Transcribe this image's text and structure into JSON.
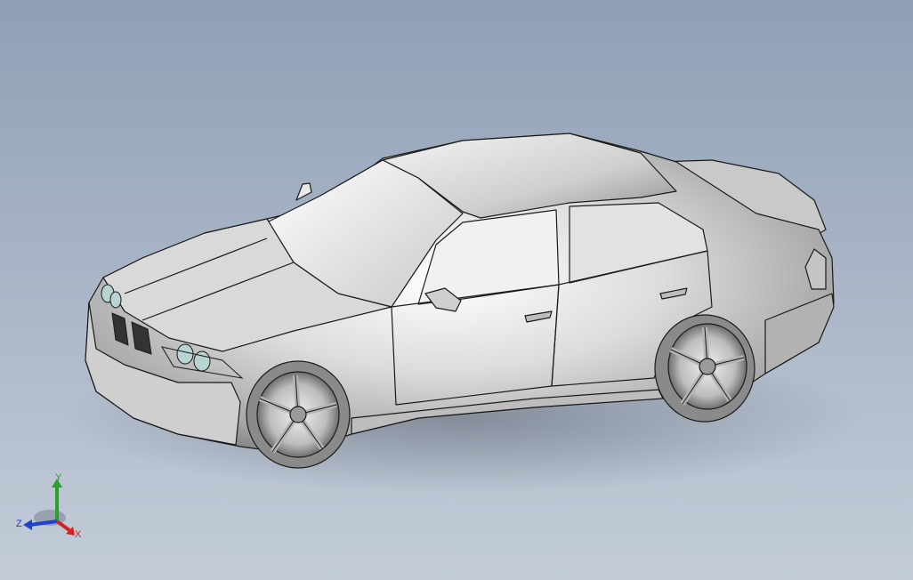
{
  "view": {
    "colors": {
      "background_top": "#8f9fb6",
      "background_bottom": "#c3ccd8",
      "model_body": "#d8d8d8",
      "model_edge": "#1a1a1a",
      "headlight_tint": "#b9d3d3"
    }
  },
  "triad": {
    "x_label": "X",
    "y_label": "Y",
    "z_label": "Z",
    "x_color": "#d32020",
    "y_color": "#2aa02a",
    "z_color": "#2040d0"
  }
}
